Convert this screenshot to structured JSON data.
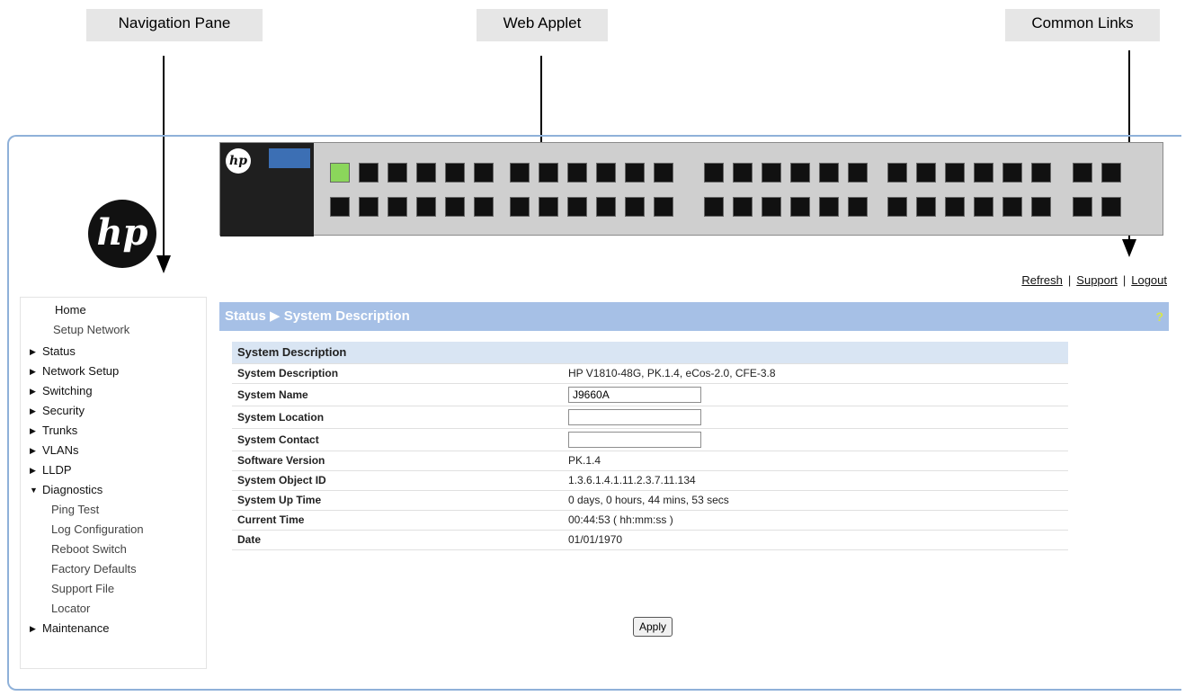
{
  "callouts": {
    "navigation": "Navigation Pane",
    "applet": "Web Applet",
    "links": "Common Links"
  },
  "logo": {
    "text": "hp"
  },
  "switch_panel": {
    "brand": "hp"
  },
  "common_links": {
    "refresh": "Refresh",
    "support": "Support",
    "logout": "Logout"
  },
  "nav": {
    "home": "Home",
    "setup_network": "Setup Network",
    "status": "Status",
    "network_setup": "Network Setup",
    "switching": "Switching",
    "security": "Security",
    "trunks": "Trunks",
    "vlans": "VLANs",
    "lldp": "LLDP",
    "diagnostics": "Diagnostics",
    "ping_test": "Ping Test",
    "log_configuration": "Log Configuration",
    "reboot_switch": "Reboot Switch",
    "factory_defaults": "Factory Defaults",
    "support_file": "Support File",
    "locator": "Locator",
    "maintenance": "Maintenance"
  },
  "page": {
    "breadcrumb": "Status ▶ System Description",
    "help_icon": "?"
  },
  "system": {
    "header": "System Description",
    "rows": [
      {
        "label": "System Description",
        "value": "HP V1810-48G, PK.1.4, eCos-2.0, CFE-3.8"
      },
      {
        "label": "System Name",
        "value": "J9660A"
      },
      {
        "label": "System Location",
        "value": ""
      },
      {
        "label": "System Contact",
        "value": ""
      },
      {
        "label": "Software Version",
        "value": "PK.1.4"
      },
      {
        "label": "System Object ID",
        "value": "1.3.6.1.4.1.11.2.3.7.11.134"
      },
      {
        "label": "System Up Time",
        "value": "0 days, 0 hours, 44 mins, 53 secs"
      },
      {
        "label": "Current Time",
        "value": "00:44:53  ( hh:mm:ss )"
      },
      {
        "label": "Date",
        "value": "01/01/1970"
      }
    ]
  },
  "buttons": {
    "apply": "Apply"
  }
}
